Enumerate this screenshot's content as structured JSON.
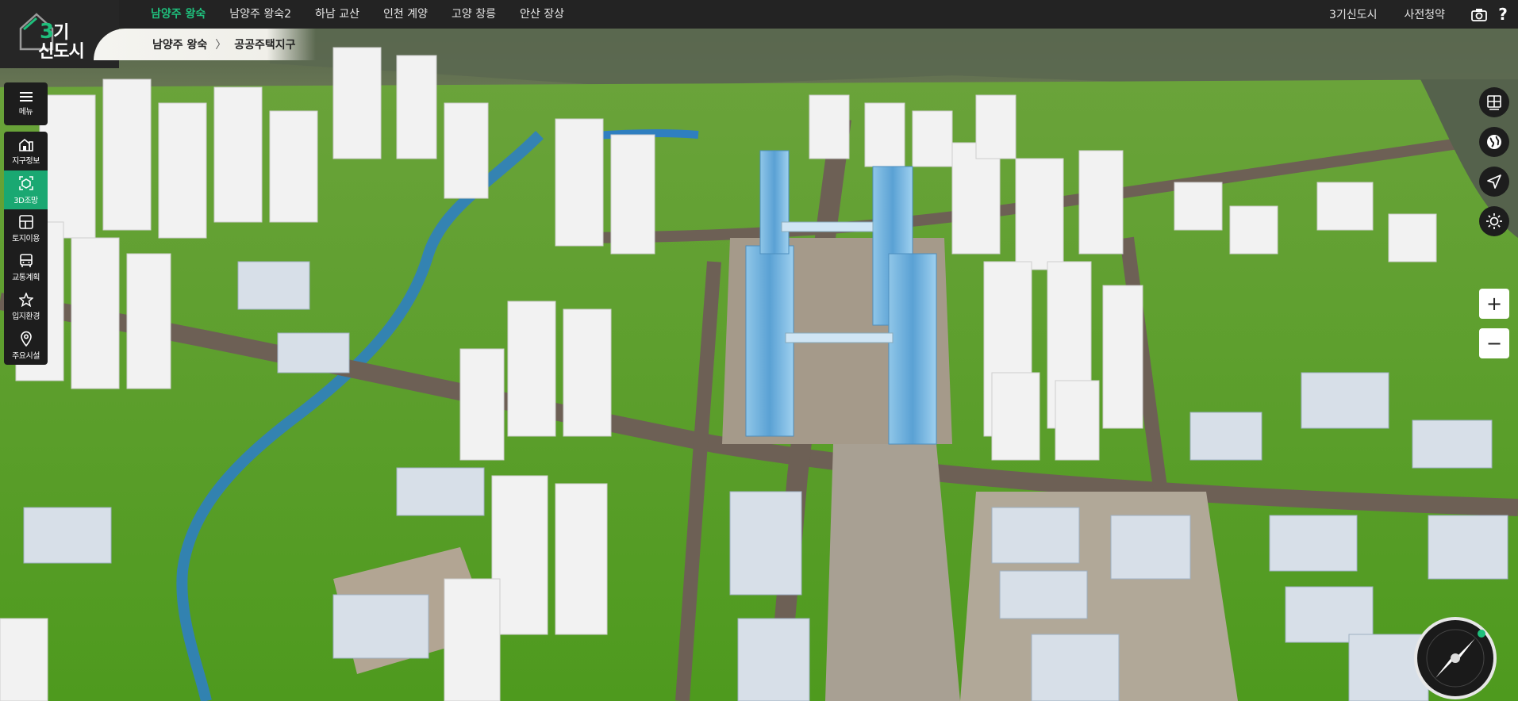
{
  "app": {
    "logo_number": "3",
    "logo_line1": "기",
    "logo_line2": "신도시"
  },
  "top_tabs": [
    {
      "label": "남양주 왕숙",
      "active": true
    },
    {
      "label": "남양주 왕숙2",
      "active": false
    },
    {
      "label": "하남 교산",
      "active": false
    },
    {
      "label": "인천 계양",
      "active": false
    },
    {
      "label": "고양 창릉",
      "active": false
    },
    {
      "label": "안산 장상",
      "active": false
    }
  ],
  "top_right": {
    "link1": "3기신도시",
    "link2": "사전청약",
    "icons": [
      "camera-icon",
      "help-icon"
    ],
    "help_glyph": "?"
  },
  "breadcrumb": {
    "item1": "남양주 왕숙",
    "separator": "〉",
    "item2": "공공주택지구"
  },
  "left_menu": {
    "menu": {
      "label": "메뉴",
      "icon": "hamburger-icon"
    },
    "items": [
      {
        "label": "지구정보",
        "icon": "district-info-icon",
        "active": false
      },
      {
        "label": "3D조망",
        "icon": "3d-view-icon",
        "active": true
      },
      {
        "label": "토지이용",
        "icon": "land-use-icon",
        "active": false
      },
      {
        "label": "교통계획",
        "icon": "bus-icon",
        "active": false
      },
      {
        "label": "입지환경",
        "icon": "star-icon",
        "active": false
      },
      {
        "label": "주요시설",
        "icon": "location-pin-icon",
        "active": false
      }
    ]
  },
  "right_tools": [
    "layers-icon",
    "globe-icon",
    "navigate-icon",
    "sun-icon"
  ],
  "zoom": {
    "in": "+",
    "out": "−"
  },
  "colors": {
    "accent_green": "#1fbf7c",
    "menu_active": "#1aa872",
    "topbar": "#232323"
  }
}
